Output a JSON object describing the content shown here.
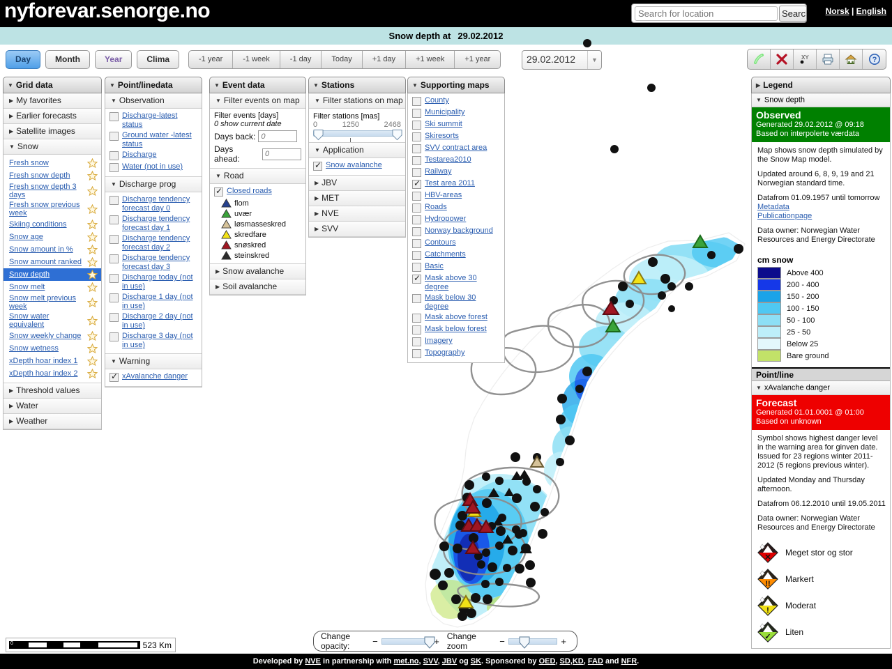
{
  "header": {
    "site_title": "nyforevar.senorge.no",
    "search_placeholder": "Search for location",
    "search_value": "",
    "search_button": "Search",
    "lang_no": "Norsk",
    "lang_sep": " | ",
    "lang_en": "English"
  },
  "title_strip": {
    "label": "Snow depth at",
    "date": "29.02.2012"
  },
  "mode_buttons": [
    {
      "label": "Day",
      "selected": true
    },
    {
      "label": "Month",
      "selected": false
    },
    {
      "label": "Year",
      "selected": false
    },
    {
      "label": "Clima",
      "selected": false
    }
  ],
  "nav_buttons": [
    "-1 year",
    "-1 week",
    "-1 day",
    "Today",
    "+1 day",
    "+1 week",
    "+1 year"
  ],
  "date_picker": {
    "value": "29.02.2012",
    "caret": "▼"
  },
  "toolbar": [
    {
      "icon": "pen-highlight-icon"
    },
    {
      "icon": "red-x-delete-icon"
    },
    {
      "icon": "xy-coordinate-icon"
    },
    {
      "icon": "printer-icon"
    },
    {
      "icon": "home-icon"
    },
    {
      "icon": "help-question-icon"
    }
  ],
  "grid_data": {
    "title": "Grid data",
    "groups": [
      {
        "label": "My favorites",
        "open": false
      },
      {
        "label": "Earlier forecasts",
        "open": false
      },
      {
        "label": "Satellite images",
        "open": false
      },
      {
        "label": "Snow",
        "open": true
      }
    ],
    "snow_items": [
      {
        "label": "Fresh snow",
        "selected": false
      },
      {
        "label": "Fresh snow depth",
        "selected": false
      },
      {
        "label": "Fresh snow depth 3 days",
        "selected": false
      },
      {
        "label": "Fresh snow previous week",
        "selected": false
      },
      {
        "label": "Skiing conditions",
        "selected": false
      },
      {
        "label": "Snow age",
        "selected": false
      },
      {
        "label": "Snow amount in %",
        "selected": false
      },
      {
        "label": "Snow amount ranked",
        "selected": false
      },
      {
        "label": "Snow depth",
        "selected": true
      },
      {
        "label": "Snow melt",
        "selected": false
      },
      {
        "label": "Snow melt previous week",
        "selected": false
      },
      {
        "label": "Snow water equivalent",
        "selected": false
      },
      {
        "label": "Snow weekly change",
        "selected": false
      },
      {
        "label": "Snow wetness",
        "selected": false
      },
      {
        "label": "xDepth hoar index 1",
        "selected": false
      },
      {
        "label": "xDepth hoar index 2",
        "selected": false
      }
    ],
    "tail_groups": [
      {
        "label": "Threshold values"
      },
      {
        "label": "Water"
      },
      {
        "label": "Weather"
      }
    ]
  },
  "point_line_data": {
    "title": "Point/linedata",
    "observation_label": "Observation",
    "observation_items": [
      {
        "label": "Discharge-latest status",
        "checked": false
      },
      {
        "label": "Ground water -latest status",
        "checked": false
      },
      {
        "label": "Discharge",
        "checked": false
      },
      {
        "label": "Water (not in use)",
        "checked": false
      }
    ],
    "discharge_prog_label": "Discharge prog",
    "discharge_items": [
      {
        "label": "Discharge tendency forecast day 0",
        "checked": false
      },
      {
        "label": "Discharge tendency forecast day 1",
        "checked": false
      },
      {
        "label": "Discharge tendency forecast day 2",
        "checked": false
      },
      {
        "label": "Discharge tendency forecast day 3",
        "checked": false
      },
      {
        "label": "Discharge today (not in use)",
        "checked": false
      },
      {
        "label": "Discharge 1 day (not in use)",
        "checked": false
      },
      {
        "label": "Discharge 2 day (not in use)",
        "checked": false
      },
      {
        "label": "Discharge 3 day (not in use)",
        "checked": false
      }
    ],
    "warning_label": "Warning",
    "warning_items": [
      {
        "label": "xAvalanche danger",
        "checked": true
      }
    ]
  },
  "event_data": {
    "title": "Event data",
    "filter_label": "Filter events on map",
    "filter_title": "Filter events [days]",
    "filter_note": "0 show current date",
    "days_back_label": "Days back:",
    "days_back_value": "0",
    "days_ahead_label": "Days ahead:",
    "days_ahead_value": "0",
    "road_label": "Road",
    "closed_roads_label": "Closed roads",
    "closed_roads_checked": true,
    "symbols": [
      {
        "label": "flom",
        "color": "#26418f"
      },
      {
        "label": "uvær",
        "color": "#3aa33a"
      },
      {
        "label": "løsmasseskred",
        "color": "#d6c39a"
      },
      {
        "label": "skredfare",
        "color": "#f2e216"
      },
      {
        "label": "snøskred",
        "color": "#a01622"
      },
      {
        "label": "steinskred",
        "color": "#2b2b2b"
      }
    ],
    "snow_avalanche_label": "Snow avalanche",
    "soil_avalanche_label": "Soil avalanche"
  },
  "stations": {
    "title": "Stations",
    "filter_label": "Filter stations on map",
    "filter_title": "Filter stations [mas]",
    "slider_min": "0",
    "slider_mid": "1250",
    "slider_max": "2468",
    "application_label": "Application",
    "application_items": [
      {
        "label": "Snow avalanche",
        "checked": true
      }
    ],
    "groups": [
      "JBV",
      "MET",
      "NVE",
      "SVV"
    ]
  },
  "supporting_maps": {
    "title": "Supporting maps",
    "items": [
      {
        "label": "County",
        "checked": false
      },
      {
        "label": "Municipality",
        "checked": false
      },
      {
        "label": "Ski summit",
        "checked": false
      },
      {
        "label": "Skiresorts",
        "checked": false
      },
      {
        "label": "SVV contract area",
        "checked": false
      },
      {
        "label": "Testarea2010",
        "checked": false
      },
      {
        "label": "Railway",
        "checked": false
      },
      {
        "label": "Test area 2011",
        "checked": true
      },
      {
        "label": "HBV-areas",
        "checked": false
      },
      {
        "label": "Roads",
        "checked": false
      },
      {
        "label": "Hydropower",
        "checked": false
      },
      {
        "label": "Norway background",
        "checked": false
      },
      {
        "label": "Contours",
        "checked": false
      },
      {
        "label": "Catchments",
        "checked": false
      },
      {
        "label": "Basic",
        "checked": false
      },
      {
        "label": "Mask above 30 degree",
        "checked": true
      },
      {
        "label": "Mask below 30 degree",
        "checked": false
      },
      {
        "label": "Mask above forest",
        "checked": false
      },
      {
        "label": "Mask below forest",
        "checked": false
      },
      {
        "label": "Imagery",
        "checked": false
      },
      {
        "label": "Topography",
        "checked": false
      }
    ]
  },
  "legend": {
    "title": "Legend",
    "snow_depth_label": "Snow depth",
    "observed_banner": {
      "title": "Observed",
      "generated": "Generated 29.02.2012 @ 09:18",
      "based_on": "Based on interpolerte værdata",
      "color": "#008000"
    },
    "desc_1": "Map shows snow depth simulated by the Snow Map model.",
    "desc_2": "Updated around 6, 8, 9, 19 and 21 Norwegian standard time.",
    "desc_3": "Datafrom 01.09.1957 until tomorrow",
    "link_metadata": "Metadata",
    "link_publication": "Publicationpage",
    "data_owner": "Data owner: Norwegian Water Resources and Energy Directorate",
    "swatch_title": "cm snow",
    "swatches": [
      {
        "label": "Above  400",
        "color": "#0c0c8c"
      },
      {
        "label": "200 - 400",
        "color": "#1538e8"
      },
      {
        "label": "150 - 200",
        "color": "#1ba3e8"
      },
      {
        "label": "100 - 150",
        "color": "#4fc8f2"
      },
      {
        "label": "50 - 100",
        "color": "#8ddff5"
      },
      {
        "label": "25 - 50",
        "color": "#bdeef9"
      },
      {
        "label": "Below 25",
        "color": "#e3f7fc"
      },
      {
        "label": "Bare ground",
        "color": "#c2e268"
      }
    ],
    "point_line_head": "Point/line",
    "avalanche_label": "xAvalanche danger",
    "forecast_banner": {
      "title": "Forecast",
      "generated": "Generated 01.01.0001 @ 01:00",
      "based_on": "Based on unknown",
      "color": "#ee0000"
    },
    "fdesc_1": "Symbol shows highest danger level in the warning area for ginven date. Issued for 23 regions winter 2011-2012 (5 regions previous  winter).",
    "fdesc_2": "Updated Monday and Thursday afternoon.",
    "fdesc_3": "Datafrom 06.12.2010 until 19.05.2011",
    "fdata_owner": "Data owner: Norwegian Water Resources and Energy Directorate",
    "danger_levels": [
      {
        "label": "Meget stor og stor",
        "color": "#e00000",
        "glyph": "✕"
      },
      {
        "label": "Markert",
        "color": "#ff8c00",
        "glyph": "!!"
      },
      {
        "label": "Moderat",
        "color": "#f2e216",
        "glyph": "!"
      },
      {
        "label": "Liten",
        "color": "#9ade3a",
        "glyph": "✓"
      }
    ]
  },
  "map_footer": {
    "scale_value": "523 Km",
    "scale_zero": "0",
    "opacity_label": "Change opacity:",
    "zoom_label": "Change zoom",
    "minus": "−",
    "plus": "+"
  },
  "footer": {
    "t1": "Developed by ",
    "l1": "NVE",
    "t2": " in partnership with ",
    "l2": "met.no",
    "t3": ", ",
    "l3": "SVV",
    "t4": ", ",
    "l4": "JBV",
    "t5": " og ",
    "l5": "SK",
    "t6": ". Sponsored by ",
    "l6": "OED",
    "t7": ", ",
    "l7": "SD,KD",
    "t8": ", ",
    "l8": "FAD",
    "t9": " and ",
    "l9": "NFR",
    "t10": "."
  }
}
